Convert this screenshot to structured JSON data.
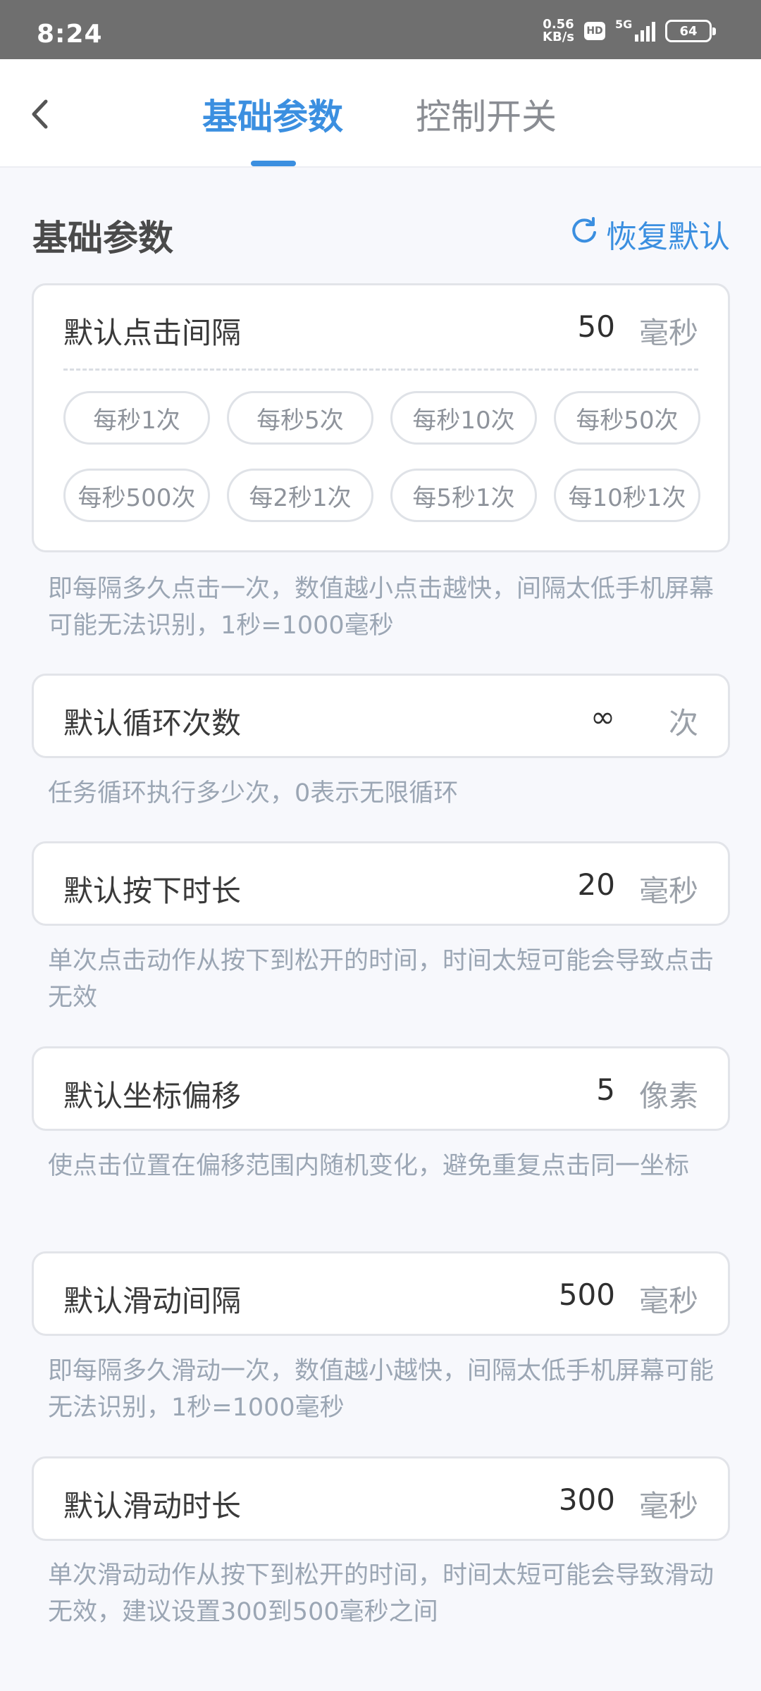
{
  "status_bar": {
    "time": "8:24",
    "net_speed_value": "0.56",
    "net_speed_unit": "KB/s",
    "hd": "HD",
    "network": "5G",
    "battery": "64"
  },
  "nav": {
    "tabs": [
      {
        "label": "基础参数",
        "active": true
      },
      {
        "label": "控制开关",
        "active": false
      }
    ]
  },
  "section": {
    "title": "基础参数",
    "reset_label": "恢复默认"
  },
  "settings": [
    {
      "label": "默认点击间隔",
      "value": "50",
      "unit": "毫秒",
      "presets": [
        "每秒1次",
        "每秒5次",
        "每秒10次",
        "每秒50次",
        "每秒500次",
        "每2秒1次",
        "每5秒1次",
        "每10秒1次"
      ],
      "description": "即每隔多久点击一次，数值越小点击越快，间隔太低手机屏幕可能无法识别，1秒=1000毫秒"
    },
    {
      "label": "默认循环次数",
      "value": "∞",
      "unit": "次",
      "description": "任务循环执行多少次，0表示无限循环"
    },
    {
      "label": "默认按下时长",
      "value": "20",
      "unit": "毫秒",
      "description": "单次点击动作从按下到松开的时间，时间太短可能会导致点击无效"
    },
    {
      "label": "默认坐标偏移",
      "value": "5",
      "unit": "像素",
      "description": "使点击位置在偏移范围内随机变化，避免重复点击同一坐标"
    },
    {
      "label": "默认滑动间隔",
      "value": "500",
      "unit": "毫秒",
      "description": "即每隔多久滑动一次，数值越小越快，间隔太低手机屏幕可能无法识别，1秒=1000毫秒"
    },
    {
      "label": "默认滑动时长",
      "value": "300",
      "unit": "毫秒",
      "description": "单次滑动动作从按下到松开的时间，时间太短可能会导致滑动无效，建议设置300到500毫秒之间"
    }
  ],
  "colors": {
    "accent": "#3b8fe0",
    "status_bar_bg": "#6f6f6f",
    "page_bg": "#f7f8fc",
    "card_border": "#e2e4e9",
    "description_text": "#9ba6b4"
  }
}
